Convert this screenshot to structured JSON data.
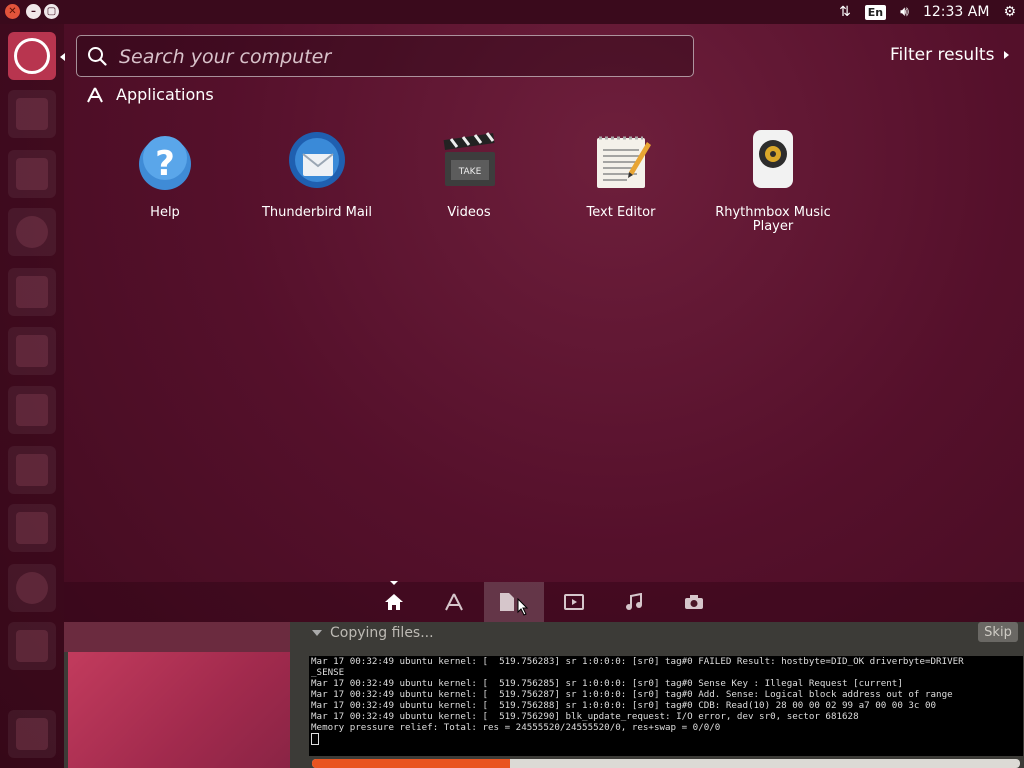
{
  "top_panel": {
    "lang_indicator": "En",
    "clock": "12:33 AM"
  },
  "launcher": {
    "items": [
      "dash-home",
      "files",
      "files-manager",
      "firefox",
      "writer",
      "calc",
      "impress",
      "software-center",
      "amazon",
      "system-settings",
      "installer",
      "trash"
    ]
  },
  "search": {
    "placeholder": "Search your computer",
    "value": ""
  },
  "filter": {
    "label": "Filter results"
  },
  "category": {
    "title": "Applications"
  },
  "apps": [
    {
      "label": "Help"
    },
    {
      "label": "Thunderbird Mail"
    },
    {
      "label": "Videos"
    },
    {
      "label": "Text Editor"
    },
    {
      "label": "Rhythmbox Music Player"
    }
  ],
  "lenses": [
    "home",
    "applications",
    "files",
    "video",
    "music",
    "photos"
  ],
  "active_lens": "files",
  "installer": {
    "status": "Copying files...",
    "skip_label": "Skip",
    "progress": 0.28,
    "log": "Mar 17 00:32:49 ubuntu kernel: [  519.756283] sr 1:0:0:0: [sr0] tag#0 FAILED Result: hostbyte=DID_OK driverbyte=DRIVER\n_SENSE\nMar 17 00:32:49 ubuntu kernel: [  519.756285] sr 1:0:0:0: [sr0] tag#0 Sense Key : Illegal Request [current]\nMar 17 00:32:49 ubuntu kernel: [  519.756287] sr 1:0:0:0: [sr0] tag#0 Add. Sense: Logical block address out of range\nMar 17 00:32:49 ubuntu kernel: [  519.756288] sr 1:0:0:0: [sr0] tag#0 CDB: Read(10) 28 00 00 02 99 a7 00 00 3c 00\nMar 17 00:32:49 ubuntu kernel: [  519.756290] blk_update_request: I/O error, dev sr0, sector 681628\nMemory pressure relief: Total: res = 24555520/24555520/0, res+swap = 0/0/0"
  },
  "colors": {
    "accent": "#e95420",
    "dash_bg": "#55102b"
  }
}
